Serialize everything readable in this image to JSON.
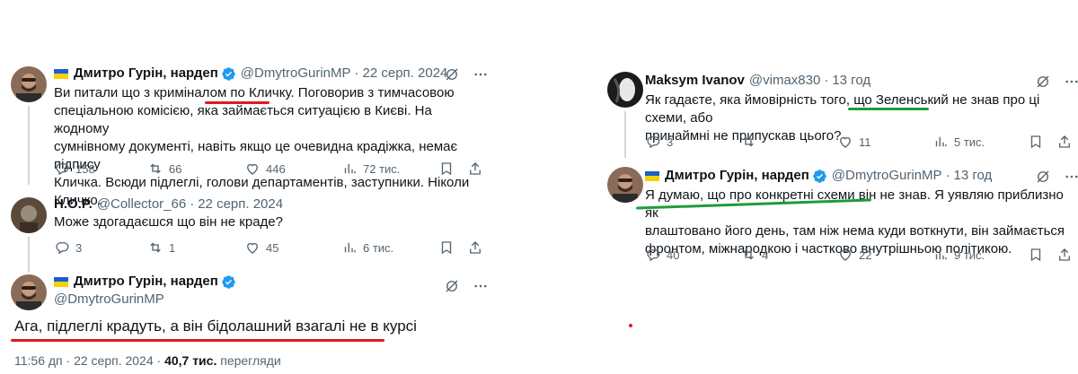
{
  "left": {
    "tweet1": {
      "author_name": "Дмитро Гурін, нардеп",
      "handle": "@DmytroGurinMP",
      "dot": "·",
      "time": "22 серп. 2024",
      "lines": [
        "Ви питали що з криміналом по Кличку. Поговорив з тимчасовою",
        "спеціальною комісією, яка займається ситуацією в Києві. На жодному",
        "сумнівному документі, навіть якщо це очевидна крадіжка, немає підпису",
        "Кличка. Всюди підлеглі, голови департаментів, заступники. Ніколи Кличко."
      ],
      "replies": "158",
      "reposts": "66",
      "likes": "446",
      "views": "72 тис."
    },
    "tweet2": {
      "author_name": "Н.О.Р.",
      "handle": "@Collector_66",
      "dot": "·",
      "time": "22 серп. 2024",
      "text": "Може здогадаєшся що він не краде?",
      "replies": "3",
      "reposts": "1",
      "likes": "45",
      "views": "6 тис."
    },
    "tweet3": {
      "author_name": "Дмитро Гурін, нардеп",
      "handle": "@DmytroGurinMP",
      "text": "Ага, підлеглі крадуть, а він бідолашний взагалі не в курсі",
      "timestamp": "11:56 дп · 22 серп. 2024 · ",
      "views_count": "40,7 тис.",
      "views_label": " перегляди"
    }
  },
  "right": {
    "tweet1": {
      "author_name": "Maksym Ivanov",
      "handle": "@vimax830",
      "dot": "·",
      "time": "13 год",
      "lines": [
        "Як гадаєте, яка ймовірність того, що Зеленський не знав про ці схеми, або",
        "принаймні не припускав цього?"
      ],
      "replies": "3",
      "reposts": "",
      "likes": "11",
      "views": "5 тис."
    },
    "tweet2": {
      "author_name": "Дмитро Гурін, нардеп",
      "handle": "@DmytroGurinMP",
      "dot": "·",
      "time": "13 год",
      "lines": [
        "Я думаю, що про конкретні схеми він не знав. Я уявляю приблизно як",
        "влаштовано його день, там ніж нема куди воткнути, він займається",
        "фронтом, міжнародкою і частково внутрішньою політикою."
      ],
      "replies": "40",
      "reposts": "4",
      "likes": "22",
      "views": "9 тис."
    }
  },
  "colors": {
    "text": "#0f1419",
    "muted": "#536471",
    "verified": "#1d9bf0",
    "red_annotation": "#e0191f",
    "green_annotation": "#1e9b3c"
  },
  "icons": [
    "verified-badge-icon",
    "grok-icon",
    "more-icon",
    "reply-icon",
    "repost-icon",
    "like-icon",
    "views-icon",
    "bookmark-icon",
    "share-icon"
  ]
}
